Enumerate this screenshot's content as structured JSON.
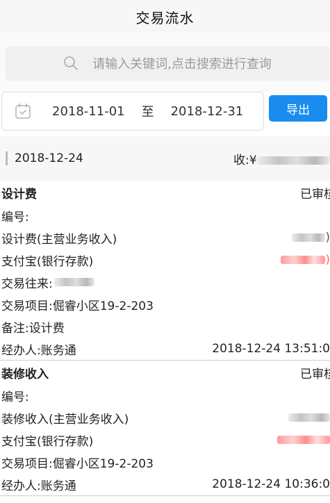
{
  "header": {
    "title": "交易流水"
  },
  "search": {
    "placeholder": "请输入关键词,点击搜索进行查询"
  },
  "filter": {
    "start_date": "2018-11-01",
    "separator": "至",
    "end_date": "2018-12-31",
    "export_label": "导出"
  },
  "day": {
    "date": "2018-12-24",
    "income_prefix": "收:¥"
  },
  "records": [
    {
      "name": "设计费",
      "status": "已审核",
      "number_label": "编号:",
      "category": "设计费(主营业务收入)",
      "account": "支付宝(银行存款)",
      "counterparty_label": "交易往来:",
      "project_label": "交易项目:",
      "project_value": "倔睿小区19-2-203",
      "remark_label": "备注:",
      "remark_value": "设计费",
      "operator_label": "经办人:",
      "operator_value": "账务通",
      "time": "2018-12-24 13:51:0"
    },
    {
      "name": "装修收入",
      "status": "已审核",
      "number_label": "编号:",
      "category": "装修收入(主营业务收入)",
      "account": "支付宝(银行存款)",
      "project_label": "交易项目:",
      "project_value": "倔睿小区19-2-203",
      "operator_label": "经办人:",
      "operator_value": "账务通",
      "time": "2018-12-24 10:36:0"
    }
  ],
  "colors": {
    "accent": "#1a8cf0",
    "amount_negative": "#ff6b6b"
  }
}
